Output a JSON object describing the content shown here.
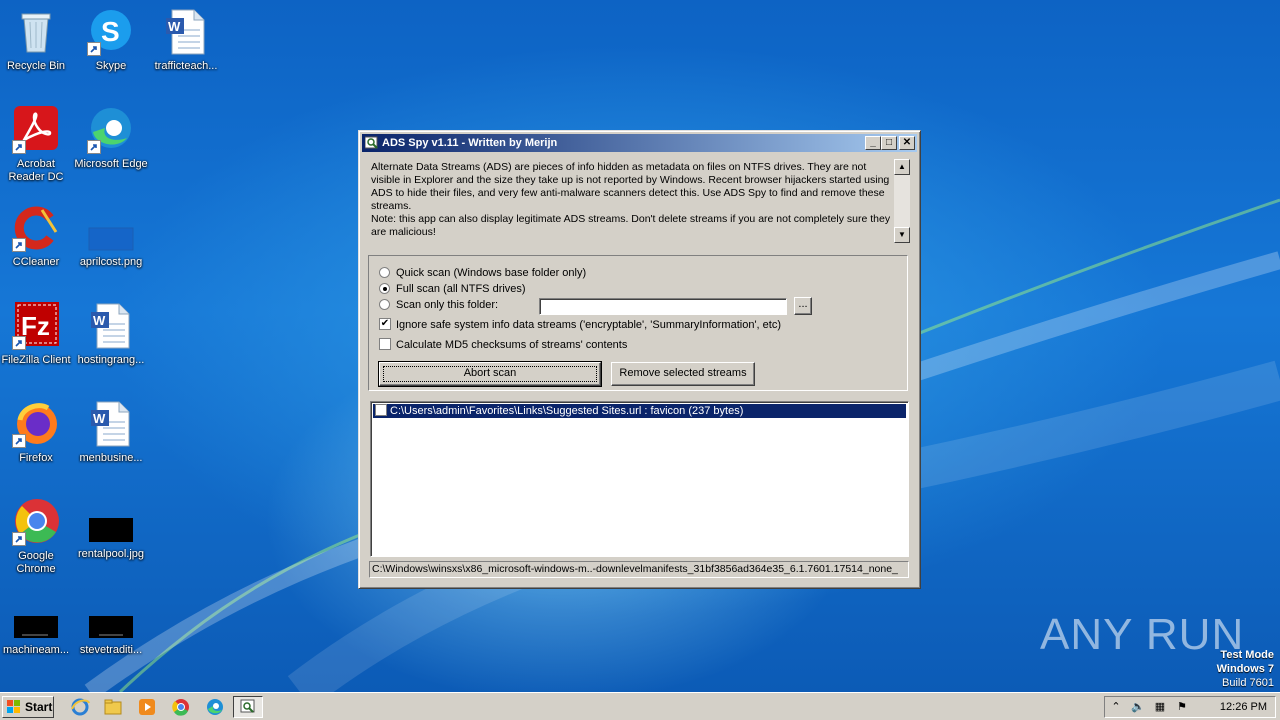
{
  "desktop": {
    "icons": [
      {
        "label": "Recycle Bin"
      },
      {
        "label": "Skype"
      },
      {
        "label": "trafficteach..."
      },
      {
        "label": "Acrobat Reader DC"
      },
      {
        "label": "Microsoft Edge"
      },
      {
        "label": "CCleaner"
      },
      {
        "label": "aprilcost.png"
      },
      {
        "label": "FileZilla Client"
      },
      {
        "label": "hostingrang..."
      },
      {
        "label": "Firefox"
      },
      {
        "label": "menbusine..."
      },
      {
        "label": "Google Chrome"
      },
      {
        "label": "rentalpool.jpg"
      },
      {
        "label": "machineam..."
      },
      {
        "label": "stevetraditi..."
      }
    ],
    "watermark": "ANY RUN",
    "test_mode": {
      "line1": "Test Mode",
      "line2": "Windows 7",
      "line3": "Build 7601"
    }
  },
  "window": {
    "title": "ADS Spy v1.11 - Written by Merijn",
    "controls": {
      "minimize": "_",
      "maximize": "□",
      "close": "✕"
    },
    "description": "Alternate Data Streams (ADS) are pieces of info hidden as metadata on files on NTFS drives. They are not visible in Explorer and the size they take up is not reported by Windows. Recent browser hijackers started using ADS to hide their files, and very few anti-malware scanners detect this. Use ADS Spy to find and remove these streams.\nNote: this app can also display legitimate ADS streams. Don't delete streams if you are not completely sure they are malicious!",
    "options": {
      "quick_scan": "Quick scan (Windows base folder only)",
      "full_scan": "Full scan (all NTFS drives)",
      "scan_folder": "Scan only this folder:",
      "folder_value": "",
      "browse_label": "...",
      "ignore_safe": "Ignore safe system info data streams ('encryptable', 'SummaryInformation', etc)",
      "calc_md5": "Calculate MD5 checksums of streams' contents",
      "selected_scan": "full_scan",
      "ignore_safe_checked": true,
      "calc_md5_checked": false
    },
    "buttons": {
      "abort": "Abort scan",
      "remove": "Remove selected streams"
    },
    "results": [
      {
        "text": "C:\\Users\\admin\\Favorites\\Links\\Suggested Sites.url : favicon  (237 bytes)",
        "checked": false,
        "selected": true
      }
    ],
    "status": "C:\\Windows\\winsxs\\x86_microsoft-windows-m..-downlevelmanifests_31bf3856ad364e35_6.1.7601.17514_none_"
  },
  "taskbar": {
    "start_label": "Start",
    "clock": "12:26 PM"
  }
}
